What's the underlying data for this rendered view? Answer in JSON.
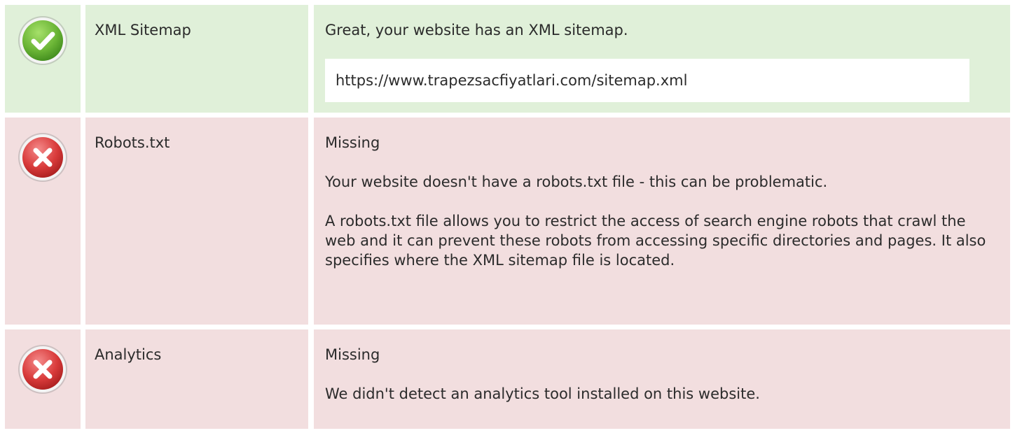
{
  "rows": [
    {
      "status": "pass",
      "icon": "check-circle-icon",
      "label": "XML Sitemap",
      "message": "Great, your website has an XML sitemap.",
      "url": "https://www.trapezsacfiyatlari.com/sitemap.xml"
    },
    {
      "status": "fail",
      "icon": "error-circle-icon",
      "label": "Robots.txt",
      "message": "Missing",
      "detail": "Your website doesn't have a robots.txt file - this can be problematic.",
      "extra": "A robots.txt file allows you to restrict the access of search engine robots that crawl the web and it can prevent these robots from accessing specific directories and pages. It also specifies where the XML sitemap file is located."
    },
    {
      "status": "fail",
      "icon": "error-circle-icon",
      "label": "Analytics",
      "message": "Missing",
      "detail": "We didn't detect an analytics tool installed on this website."
    }
  ],
  "colors": {
    "pass_bg": "#e0f0d9",
    "fail_bg": "#f2dedf",
    "pass_icon": "#6bb536",
    "fail_icon": "#d93b3b"
  }
}
